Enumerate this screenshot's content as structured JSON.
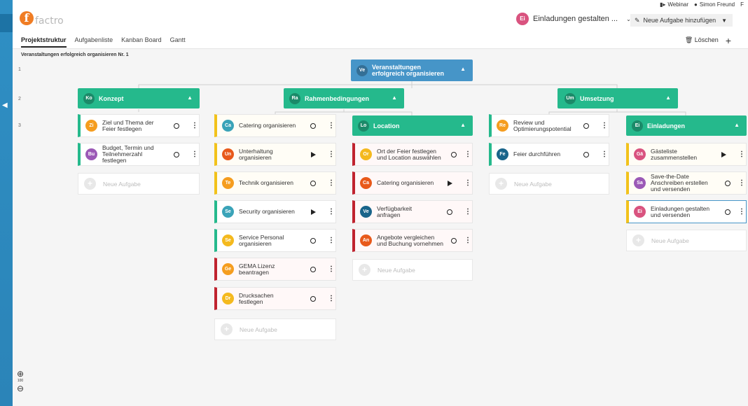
{
  "brand": {
    "logo_letter": "f",
    "logo_word": "factro"
  },
  "topbar": {
    "webinar": "Webinar",
    "user": "Simon Freund",
    "extra": "F"
  },
  "context": {
    "initials": "Ei",
    "title": "Einladungen gestalten ..."
  },
  "new_task": {
    "label": "Neue Aufgabe hinzufügen"
  },
  "tabs": [
    "Projektstruktur",
    "Aufgabenliste",
    "Kanban Board",
    "Gantt"
  ],
  "actions": {
    "delete": "Löschen",
    "add": "+"
  },
  "breadcrumb": "Veranstaltungen erfolgreich organisieren Nr. 1",
  "rows": [
    "1",
    "2",
    "3"
  ],
  "zoom": {
    "level": "100"
  },
  "root": {
    "initials": "Ve",
    "title": "Veranstaltungen erfolgreich organisieren"
  },
  "groups": {
    "konzept": {
      "initials": "Ko",
      "title": "Konzept"
    },
    "rahmen": {
      "initials": "Ra",
      "title": "Rahmenbedingungen"
    },
    "umsetzung": {
      "initials": "Um",
      "title": "Umsetzung"
    },
    "location": {
      "initials": "Lo",
      "title": "Location"
    },
    "einladungen": {
      "initials": "Ei",
      "title": "Einladungen"
    }
  },
  "new_task_placeholder": "Neue Aufgabe",
  "columns": {
    "konzept": [
      {
        "initials": "Zi",
        "title": "Ziel und Thema der Feier festlegen",
        "status": "open"
      },
      {
        "initials": "Bu",
        "title": "Budget, Termin und Teilnehmerzahl festlegen",
        "status": "open"
      }
    ],
    "rahmen": [
      {
        "initials": "Ca",
        "title": "Catering organisieren",
        "status": "open"
      },
      {
        "initials": "Un",
        "title": "Unterhaltung organisieren",
        "status": "running"
      },
      {
        "initials": "Te",
        "title": "Technik organisieren",
        "status": "open"
      },
      {
        "initials": "Se",
        "title": "Security organisieren",
        "status": "running"
      },
      {
        "initials": "Se",
        "title": "Service Personal organisieren",
        "status": "open"
      },
      {
        "initials": "Ge",
        "title": "GEMA Lizenz beantragen",
        "status": "open"
      },
      {
        "initials": "Dr",
        "title": "Drucksachen festlegen",
        "status": "open"
      }
    ],
    "location": [
      {
        "initials": "Or",
        "title": "Ort der Feier festlegen und Location auswählen",
        "status": "open"
      },
      {
        "initials": "Ca",
        "title": "Catering organisieren",
        "status": "running"
      },
      {
        "initials": "Ve",
        "title": "Verfügbarkeit anfragen",
        "status": "open"
      },
      {
        "initials": "An",
        "title": "Angebote vergleichen und Buchung vornehmen",
        "status": "open"
      }
    ],
    "umsetzung": [
      {
        "initials": "Re",
        "title": "Review und Optimierungspotential",
        "status": "open"
      },
      {
        "initials": "Fe",
        "title": "Feier durchführen",
        "status": "open"
      }
    ],
    "einladungen": [
      {
        "initials": "Gä",
        "title": "Gästeliste zusammenstellen",
        "status": "running"
      },
      {
        "initials": "Sa",
        "title": "Save-the-Date Anschreiben erstellen und versenden",
        "status": "open"
      },
      {
        "initials": "Ei",
        "title": "Einladungen gestalten und versenden",
        "status": "open"
      }
    ]
  },
  "colors": {
    "green": "#25b98c",
    "blue": "#4695c8",
    "yellow": "#f2c21b",
    "red": "#c0232f"
  }
}
